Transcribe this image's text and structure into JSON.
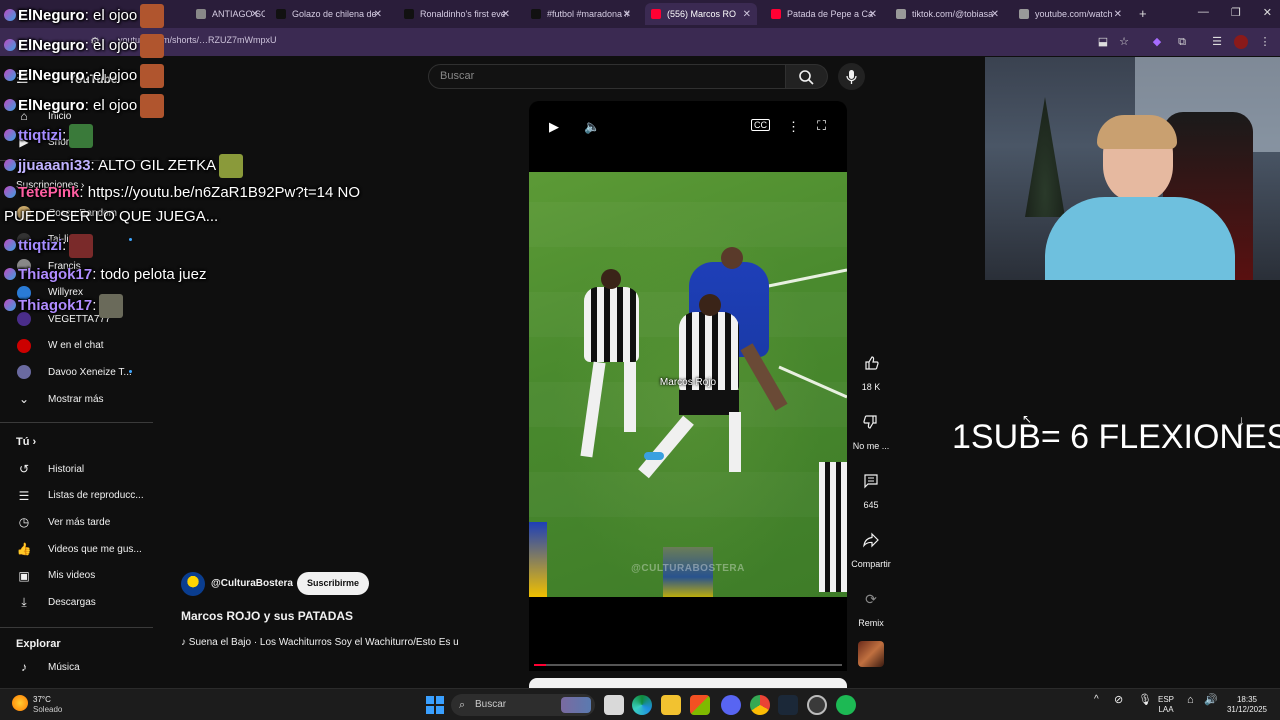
{
  "browser": {
    "tabs": [
      {
        "label": "ANTIAGO SOSA",
        "color": "#888"
      },
      {
        "label": "Golazo de chilena de",
        "color": "#111"
      },
      {
        "label": "Ronaldinho's first eve",
        "color": "#111"
      },
      {
        "label": "#futbol #maradona #",
        "color": "#111"
      },
      {
        "label": "(556) Marcos RO",
        "color": "#ff0033"
      },
      {
        "label": "Patada de Pepe a Ca",
        "color": "#ff0033"
      },
      {
        "label": "tiktok.com/@tobiasa",
        "color": "#999"
      },
      {
        "label": "youtube.com/watch",
        "color": "#999"
      }
    ],
    "new_tab": "+",
    "url": "youtube.com/shorts/…RZUZ7mWmpxU"
  },
  "sidebar": {
    "logo": "YouTube",
    "items_top": [
      {
        "label": "Inicio",
        "icon": "home-icon"
      },
      {
        "label": "Shorts",
        "icon": "shorts-icon"
      }
    ],
    "subs_header": "Suscripciones",
    "subscriptions": [
      {
        "label": "Coscu Random",
        "color": "#c9a86a"
      },
      {
        "label": "Tai-line",
        "color": "#333"
      },
      {
        "label": "Francis",
        "color": "#888"
      },
      {
        "label": "Willyrex",
        "color": "#2a7bd6"
      },
      {
        "label": "VEGETTA777",
        "color": "#4a2d8a"
      },
      {
        "label": "W en el chat",
        "color": "#cc0000"
      },
      {
        "label": "Davoo Xeneize T...",
        "color": "#6a6aa0"
      }
    ],
    "show_more": "Mostrar más",
    "you_header": "Tú",
    "you_items": [
      {
        "label": "Historial",
        "icon": "history-icon"
      },
      {
        "label": "Listas de reproducc...",
        "icon": "playlist-icon"
      },
      {
        "label": "Ver más tarde",
        "icon": "clock-icon"
      },
      {
        "label": "Videos que me gus...",
        "icon": "thumb-up-icon"
      },
      {
        "label": "Mis videos",
        "icon": "video-icon"
      },
      {
        "label": "Descargas",
        "icon": "download-icon"
      }
    ],
    "explore_header": "Explorar",
    "explore_items": [
      {
        "label": "Música",
        "icon": "music-icon"
      }
    ]
  },
  "search": {
    "placeholder": "Buscar"
  },
  "video": {
    "caption": "Marcos Rojo",
    "watermark": "@CULTURABOSTERA",
    "progress": 0.04,
    "channel": "@CulturaBostera",
    "subscribe_label": "Suscribirme",
    "title": "Marcos ROJO y sus PATADAS",
    "music": "♪ Suena el Bajo · Los Wachiturros    Soy el Wachiturro/Esto Es u"
  },
  "actions": [
    {
      "label": "18 K",
      "icon": "thumb-up-icon"
    },
    {
      "label": "No me ...",
      "icon": "thumb-down-icon"
    },
    {
      "label": "645",
      "icon": "comment-icon"
    },
    {
      "label": "Compartir",
      "icon": "share-icon"
    },
    {
      "label": "Remix",
      "icon": "remix-icon"
    }
  ],
  "stream_overlay": {
    "text": "1SUB= 6 FLEXIONES"
  },
  "chat": [
    {
      "user": "ElNeguro",
      "msg": ": el ojoo",
      "color": "#ffffff"
    },
    {
      "user": "ElNeguro",
      "msg": ": el ojoo",
      "color": "#ffffff"
    },
    {
      "user": "ElNeguro",
      "msg": ": el ojoo",
      "color": "#ffffff"
    },
    {
      "user": "ElNeguro",
      "msg": ": el ojoo",
      "color": "#ffffff"
    },
    {
      "user": "ttiqtizi",
      "msg": ":",
      "color": "#a58cff"
    },
    {
      "user": "jjuaaani33",
      "msg": ": ALTO GIL ZETKA",
      "color": "#c0b3ff"
    },
    {
      "user": "TetePink",
      "msg": ": https://youtu.be/n6ZaR1B92Pw?t=14 NO",
      "color": "#ff5fa2"
    },
    {
      "user": "",
      "msg": "PUEDE SER LO QUE JUEGA...",
      "color": "#ffffff"
    },
    {
      "user": "ttiqtizi",
      "msg": ":",
      "color": "#a58cff"
    },
    {
      "user": "Thiagok17",
      "msg": ": todo pelota juez",
      "color": "#b08cff"
    },
    {
      "user": "Thiagok17",
      "msg": ":",
      "color": "#b08cff"
    }
  ],
  "taskbar": {
    "weather_temp": "37°C",
    "weather_desc": "Soleado",
    "search_placeholder": "Buscar",
    "lang_top": "ESP",
    "lang_bottom": "LAA",
    "time": "18:35",
    "date": "31/12/2025"
  }
}
